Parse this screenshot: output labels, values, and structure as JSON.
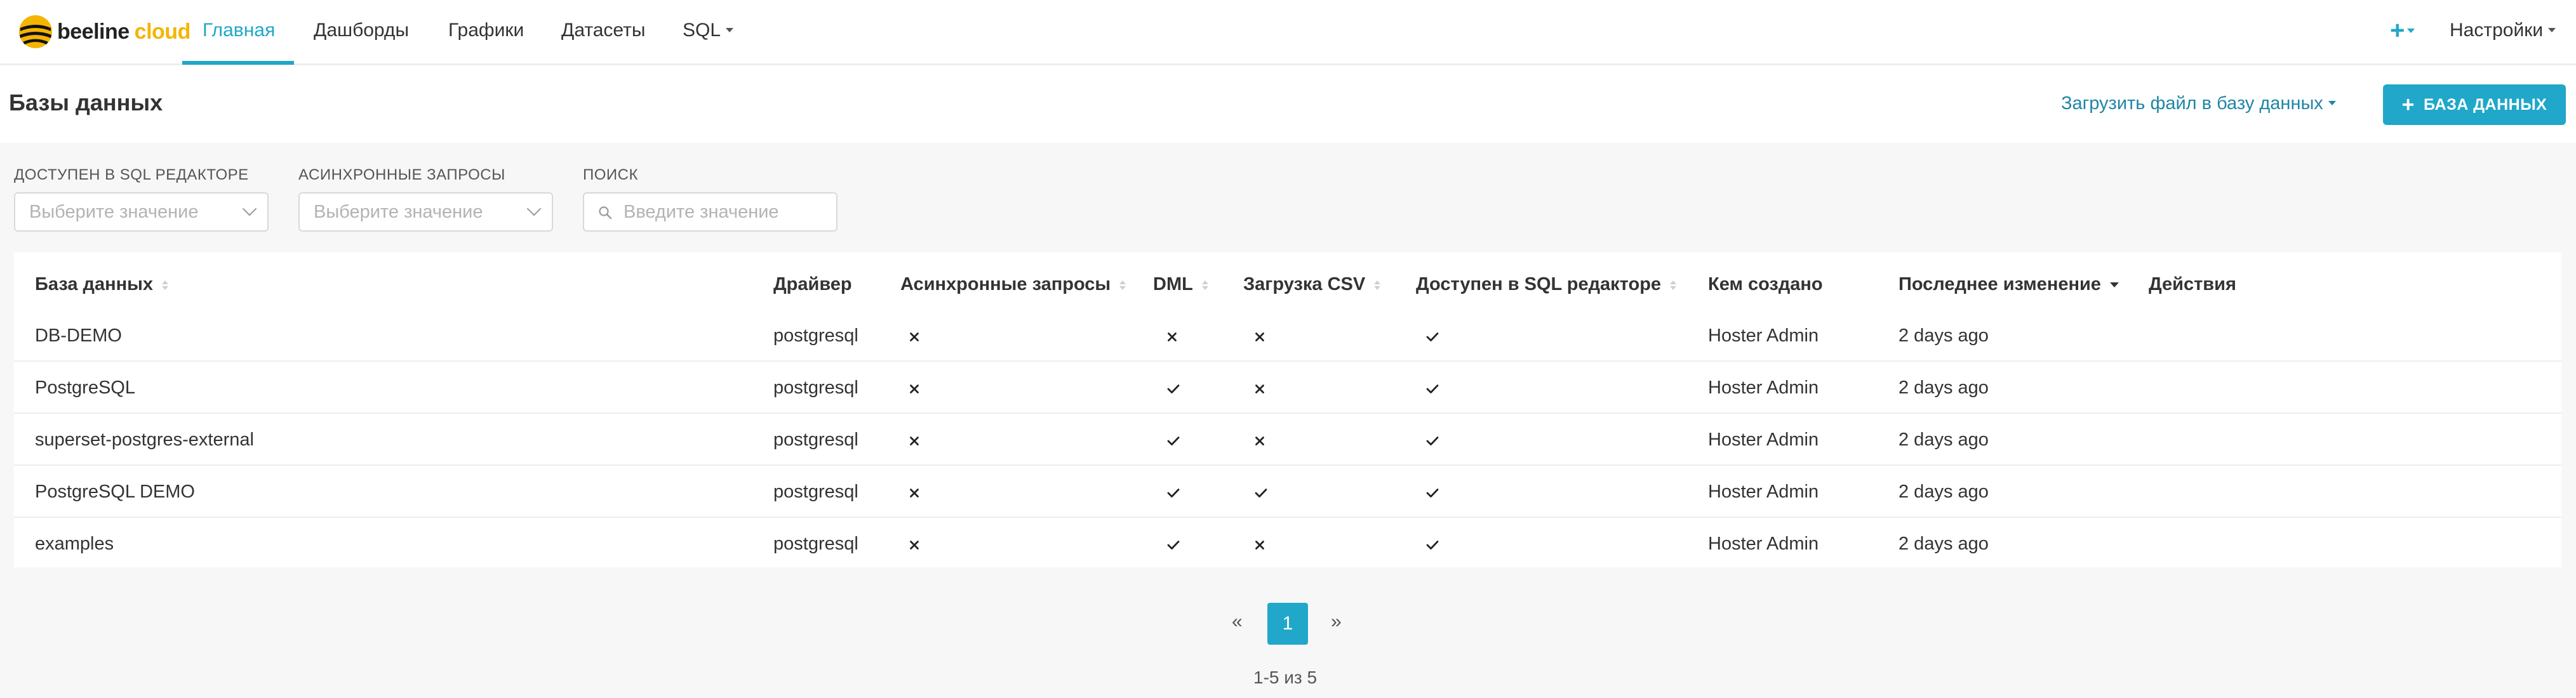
{
  "navbar": {
    "brand_primary": "beeline",
    "brand_secondary": "cloud",
    "items": [
      {
        "label": "Главная",
        "active": true
      },
      {
        "label": "Дашборды"
      },
      {
        "label": "Графики"
      },
      {
        "label": "Датасеты"
      },
      {
        "label": "SQL"
      }
    ],
    "plus_label": "+",
    "settings_label": "Настройки"
  },
  "header": {
    "title": "Базы данных",
    "upload_label": "Загрузить файл в базу данных",
    "add_button_label": "БАЗА ДАННЫХ"
  },
  "filters": {
    "sql_editor": {
      "label": "ДОСТУПЕН В SQL РЕДАКТОРЕ",
      "placeholder": "Выберите значение"
    },
    "async": {
      "label": "АСИНХРОННЫЕ ЗАПРОСЫ",
      "placeholder": "Выберите значение"
    },
    "search": {
      "label": "ПОИСК",
      "placeholder": "Введите значение"
    }
  },
  "table": {
    "columns": [
      "База данных",
      "Драйвер",
      "Асинхронные запросы",
      "DML",
      "Загрузка CSV",
      "Доступен в SQL редакторе",
      "Кем создано",
      "Последнее изменение",
      "Действия"
    ],
    "rows": [
      {
        "name": "DB-DEMO",
        "driver": "postgresql",
        "async": false,
        "dml": false,
        "csv": false,
        "sql": true,
        "created_by": "Hoster Admin",
        "modified": "2 days ago"
      },
      {
        "name": "PostgreSQL",
        "driver": "postgresql",
        "async": false,
        "dml": true,
        "csv": false,
        "sql": true,
        "created_by": "Hoster Admin",
        "modified": "2 days ago"
      },
      {
        "name": "superset-postgres-external",
        "driver": "postgresql",
        "async": false,
        "dml": true,
        "csv": false,
        "sql": true,
        "created_by": "Hoster Admin",
        "modified": "2 days ago"
      },
      {
        "name": "PostgreSQL DEMO",
        "driver": "postgresql",
        "async": false,
        "dml": true,
        "csv": true,
        "sql": true,
        "created_by": "Hoster Admin",
        "modified": "2 days ago"
      },
      {
        "name": "examples",
        "driver": "postgresql",
        "async": false,
        "dml": true,
        "csv": false,
        "sql": true,
        "created_by": "Hoster Admin",
        "modified": "2 days ago"
      }
    ]
  },
  "pagination": {
    "prev_label": "«",
    "current_page": "1",
    "next_label": "»",
    "summary": "1-5 из 5"
  },
  "colors": {
    "accent": "#20a7c9",
    "brand_yellow": "#f5b400",
    "link": "#1f86a6"
  },
  "icons": {
    "true": "check-icon",
    "false": "cross-icon"
  }
}
